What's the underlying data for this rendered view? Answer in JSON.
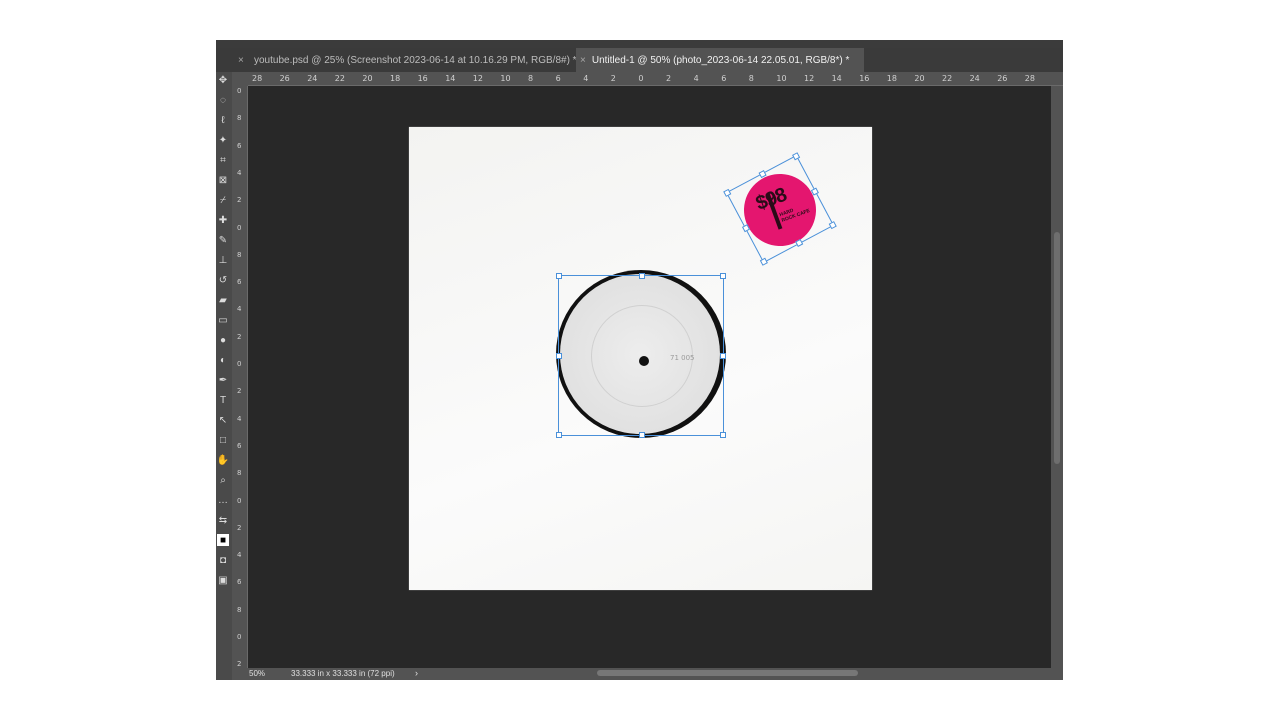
{
  "tabs": [
    {
      "label": "youtube.psd @ 25% (Screenshot 2023-06-14 at 10.16.29 PM, RGB/8#) *",
      "active": false
    },
    {
      "label": "Untitled-1 @ 50% (photo_2023-06-14 22.05.01, RGB/8*) *",
      "active": true
    }
  ],
  "tab_close_glyph": "×",
  "ruler_h": [
    "28",
    "26",
    "24",
    "22",
    "20",
    "18",
    "16",
    "14",
    "12",
    "10",
    "8",
    "6",
    "4",
    "2",
    "0",
    "2",
    "4",
    "6",
    "8",
    "10",
    "12",
    "14",
    "16",
    "18",
    "20",
    "22",
    "24",
    "26",
    "28"
  ],
  "ruler_v": [
    "0",
    "8",
    "6",
    "4",
    "2",
    "0",
    "8",
    "6",
    "4",
    "2",
    "0",
    "2",
    "4",
    "6",
    "8",
    "0",
    "2",
    "4",
    "6",
    "8",
    "0",
    "2"
  ],
  "status": {
    "zoom": "50%",
    "doc_info": "33.333 in x 33.333 in (72 ppi)",
    "arrow": "›"
  },
  "sticker": {
    "price": "$98",
    "sub": "HARD ROCK CAFE"
  },
  "record": {
    "scribble": "71 005"
  },
  "tools": [
    "move-icon",
    "marquee-icon",
    "lasso-icon",
    "magic-wand-icon",
    "crop-icon",
    "frame-icon",
    "eyedropper-icon",
    "healing-icon",
    "brush-icon",
    "stamp-icon",
    "history-brush-icon",
    "eraser-icon",
    "gradient-icon",
    "blur-icon",
    "dodge-icon",
    "pen-icon",
    "type-icon",
    "path-select-icon",
    "rectangle-icon",
    "hand-icon",
    "zoom-icon",
    "more-icon",
    "swap-colors-icon",
    "colors-icon",
    "quick-mask-icon",
    "screen-mode-icon"
  ],
  "colors": {
    "accent": "#4a90d9",
    "sticker": "#e4166f",
    "pasteboard": "#282828"
  }
}
